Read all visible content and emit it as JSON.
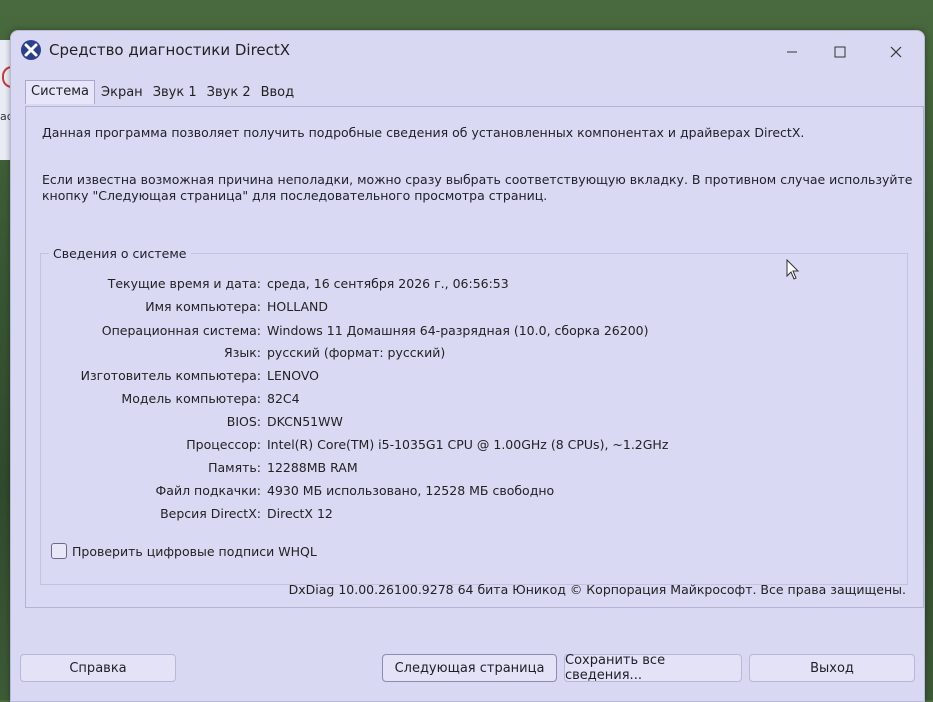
{
  "window": {
    "title": "Средство диагностики DirectX",
    "minimize_icon": "minimize-icon",
    "maximize_icon": "maximize-icon",
    "close_icon": "close-icon"
  },
  "tabs": [
    {
      "label": "Система",
      "active": true
    },
    {
      "label": "Экран",
      "active": false
    },
    {
      "label": "Звук 1",
      "active": false
    },
    {
      "label": "Звук 2",
      "active": false
    },
    {
      "label": "Ввод",
      "active": false
    }
  ],
  "intro": {
    "line1": "Данная программа позволяет получить подробные сведения об установленных компонентах и драйверах DirectX.",
    "line2": "Если известна возможная причина неполадки, можно сразу выбрать соответствующую вкладку. В противном случае используйте",
    "line3": "кнопку \"Следующая страница\" для последовательного просмотра страниц."
  },
  "system_info": {
    "legend": "Сведения о системе",
    "rows": [
      {
        "label": "Текущие время и дата:",
        "value": "среда, 16 сентября 2026 г., 06:56:53"
      },
      {
        "label": "Имя компьютера:",
        "value": "HOLLAND"
      },
      {
        "label": "Операционная система:",
        "value": "Windows 11 Домашняя 64-разрядная (10.0, сборка 26200)"
      },
      {
        "label": "Язык:",
        "value": "русский (формат: русский)"
      },
      {
        "label": "Изготовитель компьютера:",
        "value": "LENOVO"
      },
      {
        "label": "Модель компьютера:",
        "value": "82C4"
      },
      {
        "label": "BIOS:",
        "value": "DKCN51WW"
      },
      {
        "label": "Процессор:",
        "value": "Intel(R) Core(TM) i5-1035G1 CPU @ 1.00GHz (8 CPUs), ~1.2GHz"
      },
      {
        "label": "Память:",
        "value": "12288MB RAM"
      },
      {
        "label": "Файл подкачки:",
        "value": "4930 МБ использовано, 12528 МБ свободно"
      },
      {
        "label": "Версия DirectX:",
        "value": "DirectX 12"
      }
    ]
  },
  "whql": {
    "label": "Проверить цифровые подписи WHQL",
    "checked": false
  },
  "copyright": "DxDiag 10.00.26100.9278 64 бита Юникод © Корпорация Майкрософт. Все права защищены.",
  "buttons": {
    "help": "Справка",
    "next": "Следующая страница",
    "save": "Сохранить все сведения...",
    "exit": "Выход"
  },
  "background": {
    "fragment": "ac"
  }
}
